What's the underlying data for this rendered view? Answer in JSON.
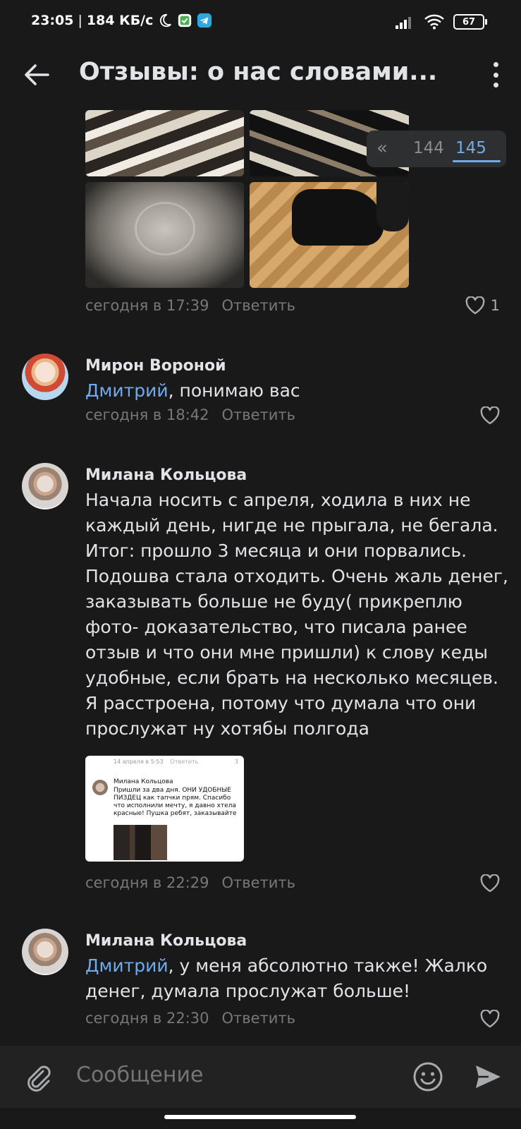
{
  "status_bar": {
    "time": "23:05",
    "speed": "184 КБ/с",
    "battery": "67"
  },
  "header": {
    "title": "Отзывы: о нас словами..."
  },
  "pager": {
    "prev_page": "144",
    "current_page": "145"
  },
  "comments": [
    {
      "time": "сегодня в 17:39",
      "reply_label": "Ответить",
      "likes": "1"
    },
    {
      "author": "Мирон Вороной",
      "mention": "Дмитрий",
      "text": ", понимаю вас",
      "time": "сегодня в 18:42",
      "reply_label": "Ответить"
    },
    {
      "author": "Милана Кольцова",
      "text": "Начала носить с апреля, ходила в них не каждый день, нигде не прыгала, не бегала. Итог: прошло 3 месяца и они порвались. Подошва стала отходить. Очень жаль денег, заказывать больше не буду( прикреплю фото- доказательство, что писала ранее отзыв и что они мне пришли) к слову кеды удобные, если брать на несколько месяцев. Я расстроена, потому что думала что они прослужат ну хотябы полгода",
      "attachment": {
        "date": "14 апреля в 5:53",
        "reply_label": "Ответить",
        "count": "3",
        "author": "Милана Кольцова",
        "text": "Пришли за два дня. ОНИ УДОБНЫЕ ПИЗДЕЦ как тапчки прям. Спасибо что исполнили мечту, я давно хтела красные! Пушка ребят, заказывайте"
      },
      "time": "сегодня в 22:29",
      "reply_label": "Ответить"
    },
    {
      "author": "Милана Кольцова",
      "mention": "Дмитрий",
      "text": ", у меня абсолютно также! Жалко денег, думала прослужат больше!",
      "time": "сегодня в 22:30",
      "reply_label": "Ответить"
    }
  ],
  "composer": {
    "placeholder": "Сообщение"
  }
}
